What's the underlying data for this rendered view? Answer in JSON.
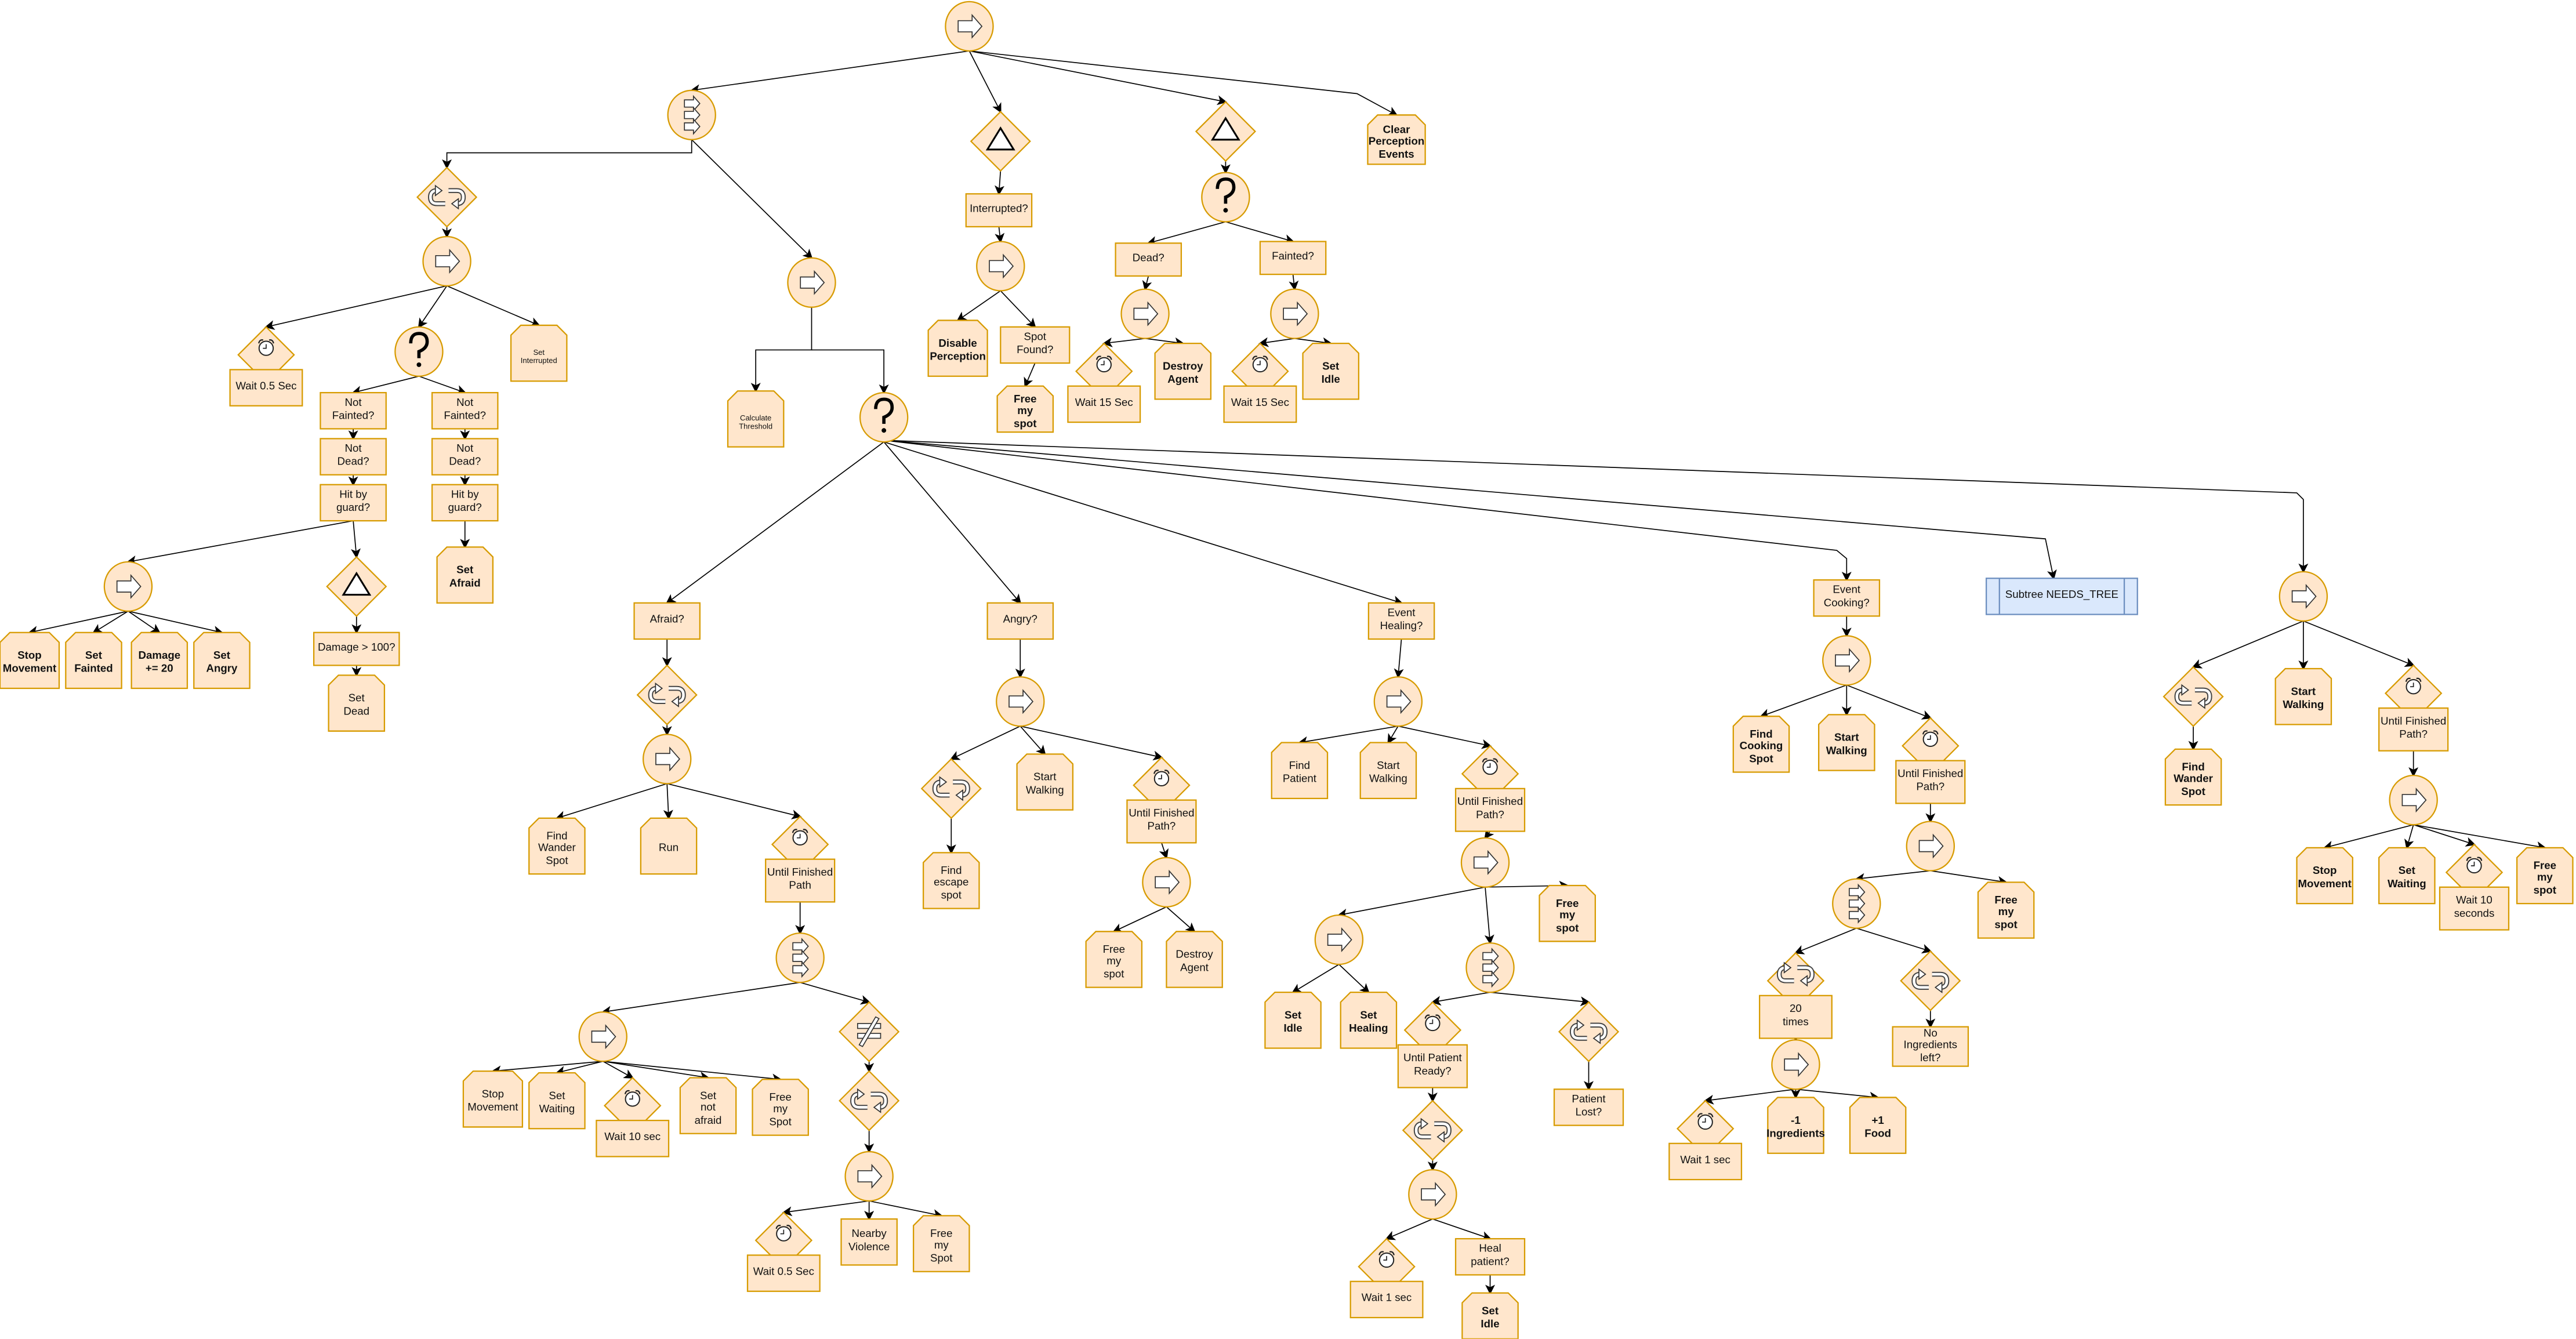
{
  "diagram": {
    "colors": {
      "node_fill": "#ffe6cc",
      "node_stroke": "#d79b00",
      "subtree_fill": "#dae8fc",
      "subtree_stroke": "#6c8ebf",
      "edge": "#000000"
    },
    "icons": {
      "seq": "arrow-right-icon",
      "par": "parallel-arrows-icon",
      "sel": "question-mark-icon",
      "rep": "repeat-loop-icon",
      "dec": "triangle-icon",
      "inv": "inverter-not-equal-icon",
      "wait": "alarm-clock-icon",
      "repbox": "repeat-loop-icon"
    },
    "nodes": {
      "n4": "Clear\nPerception\nEvents",
      "n8": "Wait 0.5 Sec",
      "n10": "Set\nInterrupted",
      "n11": "Not\nFainted?",
      "n12": "Not\nFainted?",
      "n13": "Not\nDead?",
      "n15": "Not\nDead?",
      "n14": "Hit by\nguard?",
      "n16": "Hit by\nguard?",
      "n17": "Set\nAfraid",
      "n20": "Stop\nMovement",
      "n21": "Set\nFainted",
      "n22": "Damage\n+= 20",
      "n23": "Set\nAngry",
      "n24": "Damage > 100?",
      "n25": "Set\nDead",
      "n26": "Calculate\nThreshold",
      "n28": "Interrupted?",
      "n30": "Disable\nPerception",
      "n31": "Spot\nFound?",
      "n32": "Free\nmy\nspot",
      "n34": "Dead?",
      "n35": "Fainted?",
      "n37": "Wait 15 Sec",
      "n38": "Destroy\nAgent",
      "n40": "Wait 15 Sec",
      "n41": "Set\nIdle",
      "n42": "Afraid?",
      "n43": "Angry?",
      "n44": "Event\nHealing?",
      "n45": "Event\nCooking?",
      "n46": "Subtree NEEDS_TREE",
      "n50": "Find\nWander\nSpot",
      "n51": "Run",
      "n52": "Until Finished\nPath",
      "n56": "Stop\nMovement",
      "n57": "Set\nWaiting",
      "n58": "Wait 10 sec",
      "n59": "Set\nnot\nafraid",
      "n60": "Free\nmy\nSpot",
      "n63": "Wait 0.5 Sec",
      "n64": "Nearby\nViolence",
      "n65": "Free\nmy\nSpot",
      "n68": "Find\nescape\nspot",
      "n69": "Start\nWalking",
      "n70": "Until Finished\nPath?",
      "n72": "Free\nmy\nspot",
      "n73": "Destroy\nAgent",
      "n75": "Find\nPatient",
      "n76": "Start\nWalking",
      "n77": "Until Finished\nPath?",
      "n81": "Free\nmy\nspot",
      "n82": "Set\nIdle",
      "n83": "Set\nHealing",
      "n84": "Until Patient\nReady?",
      "n86": "Patient\nLost?",
      "n89": "Wait 1 sec",
      "n90": "Heal\npatient?",
      "n91": "Set\nIdle",
      "n93": "Find\nCooking\nSpot",
      "n94": "Start\nWalking",
      "n95": "Until Finished\nPath?",
      "n98": "Free\nmy\nspot",
      "n99": "20\ntimes",
      "n100c": "No\nIngredients\nleft?",
      "n102": "Wait 1 sec",
      "n103": "-1\nIngredients",
      "n104": "+1\nFood",
      "n106": "Find\nWander\nSpot",
      "n107": "Start\nWalking",
      "n108": "Until Finished\nPath?",
      "n110": "Stop\nMovement",
      "n111": "Set\nWaiting",
      "n112": "Wait 10\nseconds",
      "n113": "Free\nmy\nspot"
    }
  }
}
